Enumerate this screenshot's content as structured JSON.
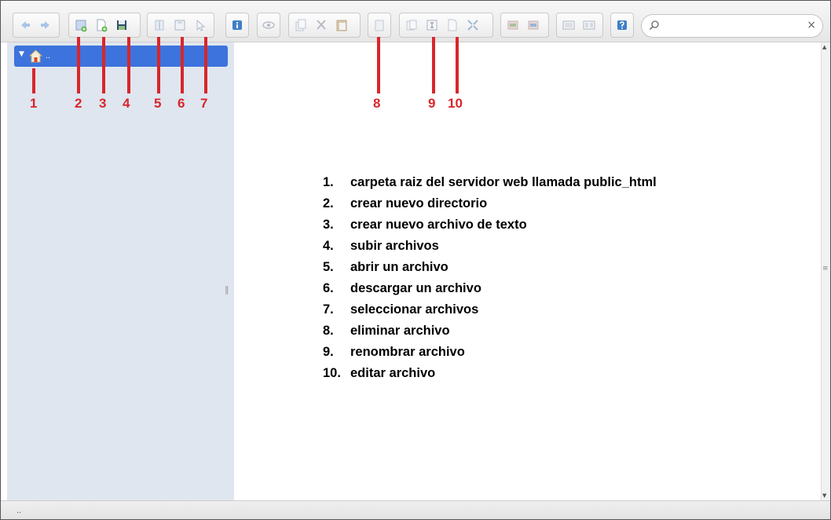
{
  "toolbar": {
    "search": {
      "placeholder": "",
      "value": "",
      "clear": "×"
    },
    "buttons": [
      {
        "name": "back",
        "icon": "arrow-left-icon"
      },
      {
        "name": "forward",
        "icon": "arrow-right-icon"
      },
      {
        "name": "new-folder",
        "icon": "folder-add-icon"
      },
      {
        "name": "new-text-file",
        "icon": "file-add-icon"
      },
      {
        "name": "upload",
        "icon": "upload-floppy-icon"
      },
      {
        "name": "open",
        "icon": "open-icon"
      },
      {
        "name": "download",
        "icon": "download-icon"
      },
      {
        "name": "select",
        "icon": "select-pointer-icon"
      },
      {
        "name": "info",
        "icon": "info-icon"
      },
      {
        "name": "preview",
        "icon": "eye-icon"
      },
      {
        "name": "copy",
        "icon": "copy-icon"
      },
      {
        "name": "cut",
        "icon": "cut-icon"
      },
      {
        "name": "paste",
        "icon": "paste-icon"
      },
      {
        "name": "delete",
        "icon": "trash-icon"
      },
      {
        "name": "duplicate",
        "icon": "duplicate-icon"
      },
      {
        "name": "rename",
        "icon": "rename-icon"
      },
      {
        "name": "edit",
        "icon": "edit-icon"
      },
      {
        "name": "resize",
        "icon": "resize-icon"
      },
      {
        "name": "archive",
        "icon": "archive-icon"
      },
      {
        "name": "extract",
        "icon": "extract-icon"
      },
      {
        "name": "view-icons",
        "icon": "view-icons-icon"
      },
      {
        "name": "view-list",
        "icon": "view-list-icon"
      },
      {
        "name": "help",
        "icon": "help-icon"
      }
    ]
  },
  "sidebar": {
    "root": {
      "label": "..",
      "icon": "home-icon"
    }
  },
  "status": {
    "text": ".."
  },
  "markers": [
    "1",
    "2",
    "3",
    "4",
    "5",
    "6",
    "7",
    "8",
    "9",
    "10"
  ],
  "legend": {
    "items": [
      {
        "num": "1.",
        "text": "carpeta raiz del servidor web llamada public_html"
      },
      {
        "num": "2.",
        "text": "crear nuevo directorio"
      },
      {
        "num": "3.",
        "text": "crear nuevo archivo de texto"
      },
      {
        "num": "4.",
        "text": "subir archivos"
      },
      {
        "num": "5.",
        "text": "abrir un archivo"
      },
      {
        "num": "6.",
        "text": "descargar un archivo"
      },
      {
        "num": "7.",
        "text": "seleccionar archivos"
      },
      {
        "num": "8.",
        "text": "eliminar archivo"
      },
      {
        "num": "9.",
        "text": "renombrar archivo"
      },
      {
        "num": "10.",
        "text": "editar archivo"
      }
    ]
  },
  "colors": {
    "marker": "#d8262b",
    "selection": "#3d73dc",
    "sidebar": "#dfe6ef"
  }
}
